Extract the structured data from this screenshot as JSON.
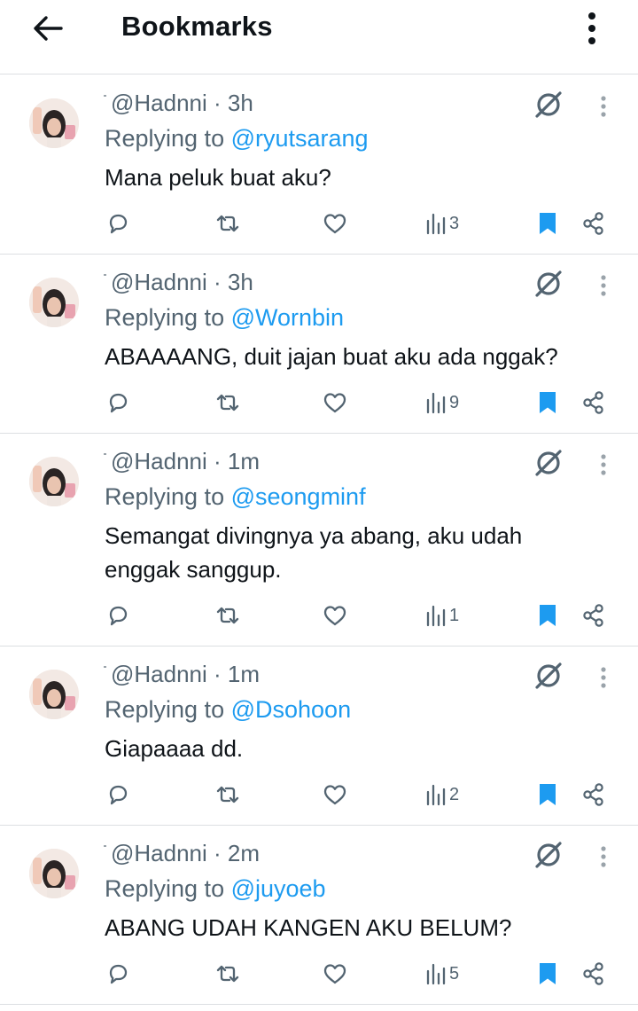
{
  "header": {
    "title": "Bookmarks",
    "back_icon": "arrow-left-icon",
    "more_icon": "more-vertical-icon"
  },
  "colors": {
    "mention": "#1d9bf0",
    "secondary_text": "#536471",
    "primary_text": "#0f1419",
    "bookmark_active": "#1d9bf0",
    "divider": "#dcdfe2"
  },
  "tweets": [
    {
      "meta": "@Hadnni · 3h",
      "replying_prefix": "Replying to ",
      "replying_to": "@ryutsarang",
      "text": "Mana peluk buat aku?",
      "views": "3",
      "bookmarked": true
    },
    {
      "meta": "@Hadnni · 3h",
      "replying_prefix": "Replying to ",
      "replying_to": "@Wornbin",
      "text": "ABAAAANG, duit jajan buat aku ada nggak?",
      "views": "9",
      "bookmarked": true
    },
    {
      "meta": "@Hadnni · 1m",
      "replying_prefix": "Replying to ",
      "replying_to": "@seongminf",
      "text": "Semangat divingnya ya abang, aku udah enggak sanggup.",
      "views": "1",
      "bookmarked": true
    },
    {
      "meta": "@Hadnni · 1m",
      "replying_prefix": "Replying to ",
      "replying_to": "@Dsohoon",
      "text": "Giapaaaa dd.",
      "views": "2",
      "bookmarked": true
    },
    {
      "meta": "@Hadnni · 2m",
      "replying_prefix": "Replying to ",
      "replying_to": "@juyoeb",
      "text": "ABANG UDAH KANGEN AKU BELUM?",
      "views": "5",
      "bookmarked": true
    }
  ]
}
